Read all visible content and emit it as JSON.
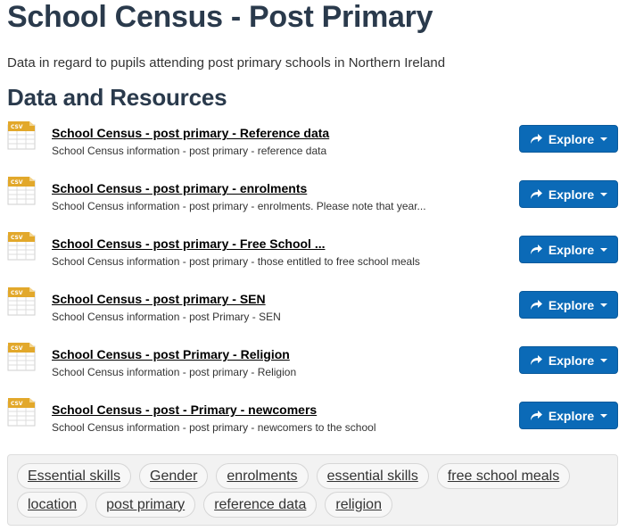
{
  "page": {
    "title": "School Census - Post Primary",
    "description": "Data in regard to pupils attending post primary schools in Northern Ireland",
    "resources_heading": "Data and Resources"
  },
  "resources": [
    {
      "format": "CSV",
      "title": "School Census - post primary - Reference data",
      "description": "School Census information - post primary - reference data",
      "button_label": "Explore"
    },
    {
      "format": "CSV",
      "title": "School Census - post primary - enrolments",
      "description": "School Census information - post primary - enrolments. Please note that year...",
      "button_label": "Explore"
    },
    {
      "format": "CSV",
      "title": "School Census - post primary - Free School ...",
      "description": "School Census information - post primary - those entitled to free school meals",
      "button_label": "Explore"
    },
    {
      "format": "CSV",
      "title": "School Census - post primary - SEN",
      "description": "School Census information - post Primary - SEN",
      "button_label": "Explore"
    },
    {
      "format": "CSV",
      "title": "School Census - post Primary - Religion",
      "description": "School Census information - post primary - Religion",
      "button_label": "Explore"
    },
    {
      "format": "CSV",
      "title": "School Census - post - Primary - newcomers",
      "description": "School Census information - post primary - newcomers to the school",
      "button_label": "Explore"
    }
  ],
  "tags": [
    "Essential skills",
    "Gender",
    "enrolments",
    "essential skills",
    "free school meals",
    "location",
    "post primary",
    "reference data",
    "religion"
  ],
  "colors": {
    "heading": "#2a3a4c",
    "button": "#0b6ab7",
    "csv_icon": "#e2a82b"
  },
  "icons": {
    "resource": "csv-file-icon",
    "button": "share-arrow-icon",
    "dropdown": "caret-down-icon"
  }
}
